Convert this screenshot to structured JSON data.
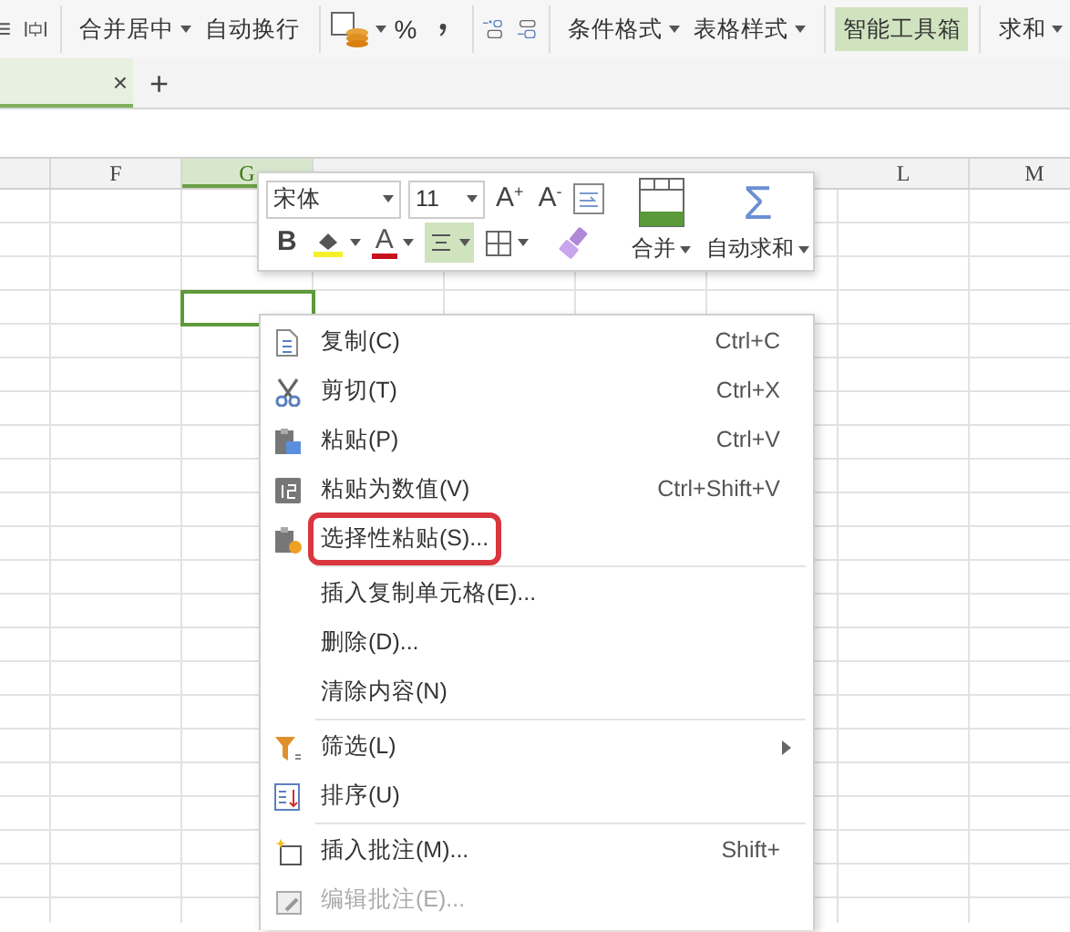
{
  "ribbon": {
    "merge_center": "合并居中",
    "wrap_text": "自动换行",
    "percent": "%",
    "conditional_format": "条件格式",
    "table_style": "表格样式",
    "toolbox": {
      "label": "智能工具箱",
      "selected": true
    },
    "sum": "求和"
  },
  "sheet_tab": {
    "selected": true,
    "close": "×",
    "add": "+"
  },
  "columns": [
    {
      "label": "F",
      "selected": false
    },
    {
      "label": "G",
      "selected": true
    },
    {
      "label": "L",
      "selected": false
    },
    {
      "label": "M",
      "selected": false
    }
  ],
  "cell_selection_visible": true,
  "mini_toolbar": {
    "font": "宋体",
    "size": "11",
    "grow_font": "A$^{+}$",
    "shrink_font": "A$^{-}$",
    "bold": "B",
    "font_color": "A",
    "align_selected": true,
    "merge": "合并",
    "autosum_symbol": "Σ",
    "autosum": "自动求和"
  },
  "context_menu": [
    {
      "label": "复制(C)",
      "shortcut": "Ctrl+C",
      "disabled": false,
      "highlighted": false
    },
    {
      "label": "剪切(T)",
      "shortcut": "Ctrl+X",
      "disabled": false,
      "highlighted": false
    },
    {
      "label": "粘贴(P)",
      "shortcut": "Ctrl+V",
      "disabled": false,
      "highlighted": false
    },
    {
      "label": "粘贴为数值(V)",
      "shortcut": "Ctrl+Shift+V",
      "disabled": false,
      "highlighted": false
    },
    {
      "label": "选择性粘贴(S)...",
      "disabled": false,
      "highlighted": true
    },
    {
      "label": "插入复制单元格(E)...",
      "separator_before": true,
      "disabled": false,
      "highlighted": false
    },
    {
      "label": "删除(D)...",
      "disabled": false,
      "highlighted": false
    },
    {
      "label": "清除内容(N)",
      "disabled": false,
      "highlighted": false
    },
    {
      "label": "筛选(L)",
      "separator_before": true,
      "submenu": true,
      "disabled": false,
      "highlighted": false
    },
    {
      "label": "排序(U)",
      "disabled": false,
      "highlighted": false
    },
    {
      "label": "插入批注(M)...",
      "shortcut": "Shift+",
      "separator_before": true,
      "disabled": false,
      "highlighted": false
    },
    {
      "label": "编辑批注(E)...",
      "disabled": true,
      "highlighted": false
    }
  ]
}
